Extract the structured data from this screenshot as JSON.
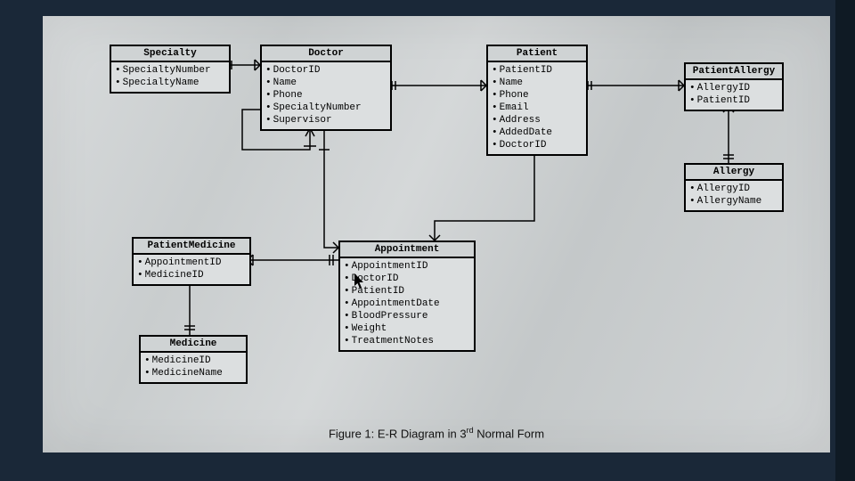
{
  "caption": {
    "prefix": "Figure 1: E-R Diagram in 3",
    "sup": "rd",
    "suffix": " Normal Form"
  },
  "entities": {
    "specialty": {
      "title": "Specialty",
      "attrs": [
        "SpecialtyNumber",
        "SpecialtyName"
      ]
    },
    "doctor": {
      "title": "Doctor",
      "attrs": [
        "DoctorID",
        "Name",
        "Phone",
        "SpecialtyNumber",
        "Supervisor"
      ]
    },
    "patient": {
      "title": "Patient",
      "attrs": [
        "PatientID",
        "Name",
        "Phone",
        "Email",
        "Address",
        "AddedDate",
        "DoctorID"
      ]
    },
    "patientAllergy": {
      "title": "PatientAllergy",
      "attrs": [
        "AllergyID",
        "PatientID"
      ]
    },
    "allergy": {
      "title": "Allergy",
      "attrs": [
        "AllergyID",
        "AllergyName"
      ]
    },
    "patientMedicine": {
      "title": "PatientMedicine",
      "attrs": [
        "AppointmentID",
        "MedicineID"
      ]
    },
    "appointment": {
      "title": "Appointment",
      "attrs": [
        "AppointmentID",
        "DoctorID",
        "PatientID",
        "AppointmentDate",
        "BloodPressure",
        "Weight",
        "TreatmentNotes"
      ]
    },
    "medicine": {
      "title": "Medicine",
      "attrs": [
        "MedicineID",
        "MedicineName"
      ]
    }
  },
  "relationships": [
    {
      "from": "Specialty",
      "to": "Doctor",
      "fk": "SpecialtyNumber",
      "card": "1:N"
    },
    {
      "from": "Doctor",
      "to": "Doctor",
      "fk": "Supervisor",
      "card": "1:N",
      "self": true
    },
    {
      "from": "Doctor",
      "to": "Patient",
      "fk": "DoctorID",
      "card": "1:N"
    },
    {
      "from": "Patient",
      "to": "PatientAllergy",
      "fk": "PatientID",
      "card": "1:N"
    },
    {
      "from": "Allergy",
      "to": "PatientAllergy",
      "fk": "AllergyID",
      "card": "1:N"
    },
    {
      "from": "Doctor",
      "to": "Appointment",
      "fk": "DoctorID",
      "card": "1:N"
    },
    {
      "from": "Patient",
      "to": "Appointment",
      "fk": "PatientID",
      "card": "1:N"
    },
    {
      "from": "Appointment",
      "to": "PatientMedicine",
      "fk": "AppointmentID",
      "card": "1:N"
    },
    {
      "from": "Medicine",
      "to": "PatientMedicine",
      "fk": "MedicineID",
      "card": "1:N"
    }
  ]
}
